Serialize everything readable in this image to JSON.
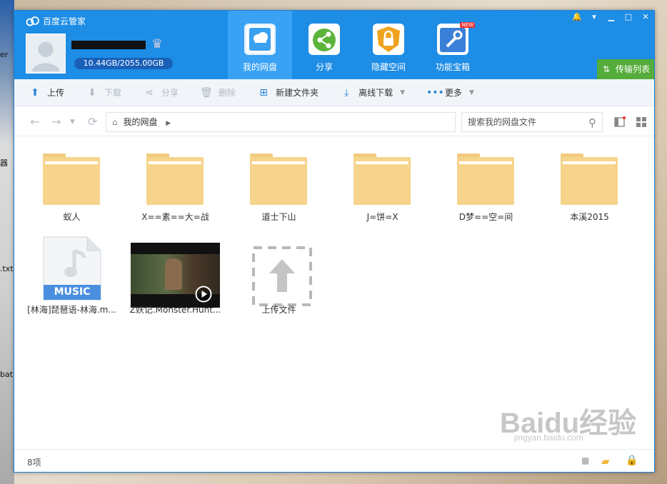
{
  "window": {
    "title": "百度云管家"
  },
  "user": {
    "quota": "10.44GB/2055.00GB"
  },
  "nav": [
    {
      "label": "我的网盘",
      "icon": "cloud-disk-icon",
      "color": "#3aa0f0"
    },
    {
      "label": "分享",
      "icon": "share-icon",
      "color": "#5cb53b"
    },
    {
      "label": "隐藏空间",
      "icon": "lock-icon",
      "color": "#f0a31e"
    },
    {
      "label": "功能宝箱",
      "icon": "toolbox-icon",
      "color": "#3a7fd8",
      "badge": "NEW"
    }
  ],
  "transfer": {
    "label": "传输列表"
  },
  "toolbar": {
    "upload": "上传",
    "download": "下载",
    "share": "分享",
    "delete": "删除",
    "new_folder": "新建文件夹",
    "offline": "离线下载",
    "more": "更多"
  },
  "path": {
    "crumb": "我的网盘",
    "search_placeholder": "搜索我的网盘文件"
  },
  "folders": [
    "蚁人",
    "X==素==大=战",
    "道士下山",
    "J=饼=X",
    "D梦==空=间",
    "本溪2015"
  ],
  "files": [
    {
      "name": "[林海]琵琶语-林海.m...",
      "type": "music",
      "badge": "MUSIC"
    },
    {
      "name": "Z妖记.Monster.Hunt...",
      "type": "video"
    },
    {
      "name": "上传文件",
      "type": "upload"
    }
  ],
  "status": {
    "count": "8项"
  },
  "watermark": {
    "brand": "Baidu经验",
    "url": "jingyan.baidu.com"
  }
}
